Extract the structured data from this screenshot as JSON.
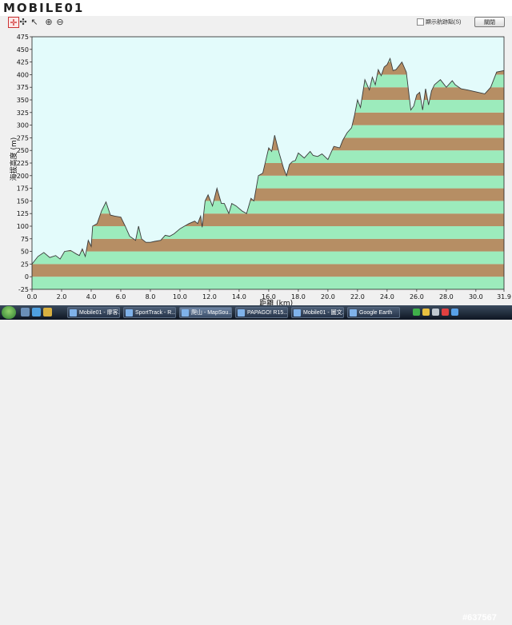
{
  "brand": {
    "logo_text": "MOBILE01"
  },
  "toolbar": {
    "tools": [
      {
        "name": "crosshair-tool-button",
        "icon": "crosshair-icon",
        "glyph": "✛",
        "active": true
      },
      {
        "name": "pan-tool-button",
        "icon": "pan-cross-icon",
        "glyph": "✣",
        "active": false
      },
      {
        "name": "pointer-tool-button",
        "icon": "arrow-cursor-icon",
        "glyph": "↖",
        "active": false
      },
      {
        "name": "zoom-in-button",
        "icon": "zoom-in-icon",
        "glyph": "⊕",
        "active": false
      },
      {
        "name": "zoom-out-button",
        "icon": "zoom-out-icon",
        "glyph": "⊖",
        "active": false
      }
    ],
    "show_track_label": "顯示航跡點(S)",
    "show_track_checked": false,
    "close_label": "關閉"
  },
  "chart_data": {
    "type": "area",
    "ylabel": "海拔高度 (m)",
    "xlabel": "距離 (km)",
    "xlim": [
      0.0,
      31.9
    ],
    "ylim": [
      -25,
      475
    ],
    "x_ticks": [
      "0.0",
      "2.0",
      "4.0",
      "6.0",
      "8.0",
      "10.0",
      "12.0",
      "14.0",
      "16.0",
      "18.0",
      "20.0",
      "22.0",
      "24.0",
      "26.0",
      "28.0",
      "30.0",
      "31.9"
    ],
    "y_ticks": [
      "475",
      "450",
      "425",
      "400",
      "375",
      "350",
      "325",
      "300",
      "275",
      "250",
      "225",
      "200",
      "175",
      "150",
      "125",
      "100",
      "75",
      "50",
      "25",
      "0",
      "-25"
    ],
    "band_colors": [
      "#9cebbc",
      "#b68e64"
    ],
    "band_size": 25,
    "background": "#e3fbfb",
    "x": [
      0.0,
      0.4,
      0.8,
      1.2,
      1.6,
      1.9,
      2.2,
      2.6,
      3.0,
      3.2,
      3.4,
      3.6,
      3.8,
      4.0,
      4.1,
      4.4,
      4.7,
      5.0,
      5.3,
      5.6,
      6.0,
      6.3,
      6.6,
      7.0,
      7.2,
      7.4,
      7.7,
      8.0,
      8.3,
      8.7,
      9.0,
      9.3,
      9.6,
      10.0,
      10.3,
      10.6,
      11.0,
      11.2,
      11.4,
      11.5,
      11.7,
      11.9,
      12.2,
      12.5,
      12.8,
      13.0,
      13.3,
      13.5,
      13.8,
      14.2,
      14.5,
      14.8,
      15.0,
      15.3,
      15.6,
      15.8,
      16.0,
      16.2,
      16.4,
      16.7,
      17.0,
      17.2,
      17.4,
      17.6,
      17.8,
      18.0,
      18.4,
      18.8,
      19.0,
      19.3,
      19.6,
      20.0,
      20.4,
      20.8,
      21.0,
      21.3,
      21.6,
      21.8,
      22.0,
      22.2,
      22.5,
      22.8,
      23.0,
      23.2,
      23.4,
      23.6,
      23.8,
      24.0,
      24.2,
      24.4,
      24.6,
      25.0,
      25.3,
      25.6,
      25.8,
      26.0,
      26.2,
      26.4,
      26.6,
      26.8,
      27.0,
      27.2,
      27.6,
      28.0,
      28.4,
      28.6,
      29.0,
      29.4,
      30.0,
      30.6,
      31.0,
      31.4,
      31.9
    ],
    "y": [
      25,
      40,
      48,
      38,
      42,
      35,
      50,
      52,
      45,
      42,
      55,
      40,
      72,
      60,
      100,
      105,
      130,
      148,
      122,
      120,
      118,
      100,
      80,
      72,
      100,
      75,
      68,
      68,
      70,
      72,
      82,
      80,
      85,
      95,
      100,
      105,
      110,
      105,
      120,
      98,
      150,
      162,
      140,
      175,
      145,
      145,
      125,
      145,
      140,
      130,
      125,
      155,
      150,
      200,
      205,
      230,
      255,
      248,
      280,
      245,
      215,
      200,
      222,
      228,
      230,
      245,
      235,
      248,
      240,
      238,
      243,
      232,
      258,
      255,
      270,
      285,
      295,
      320,
      350,
      335,
      390,
      370,
      395,
      380,
      410,
      398,
      415,
      420,
      432,
      408,
      410,
      425,
      405,
      330,
      338,
      360,
      365,
      330,
      372,
      340,
      368,
      380,
      390,
      375,
      388,
      380,
      372,
      370,
      366,
      362,
      375,
      405,
      408
    ]
  },
  "taskbar": {
    "tasks": [
      {
        "name": "taskbar-item-mobile01",
        "label": "Mobile01 - 摩客...",
        "active": false
      },
      {
        "name": "taskbar-item-sporttrack",
        "label": "SportTrack - R...",
        "active": false
      },
      {
        "name": "taskbar-item-mapsource",
        "label": "爬山 - MapSou...",
        "active": true
      },
      {
        "name": "taskbar-item-papago",
        "label": "PAPAGO! R15...",
        "active": false
      },
      {
        "name": "taskbar-item-mobile01-b",
        "label": "Mobile01 - 圖文...",
        "active": false
      },
      {
        "name": "taskbar-item-google-earth",
        "label": "Google Earth",
        "active": false
      }
    ]
  },
  "watermark": "#637567"
}
